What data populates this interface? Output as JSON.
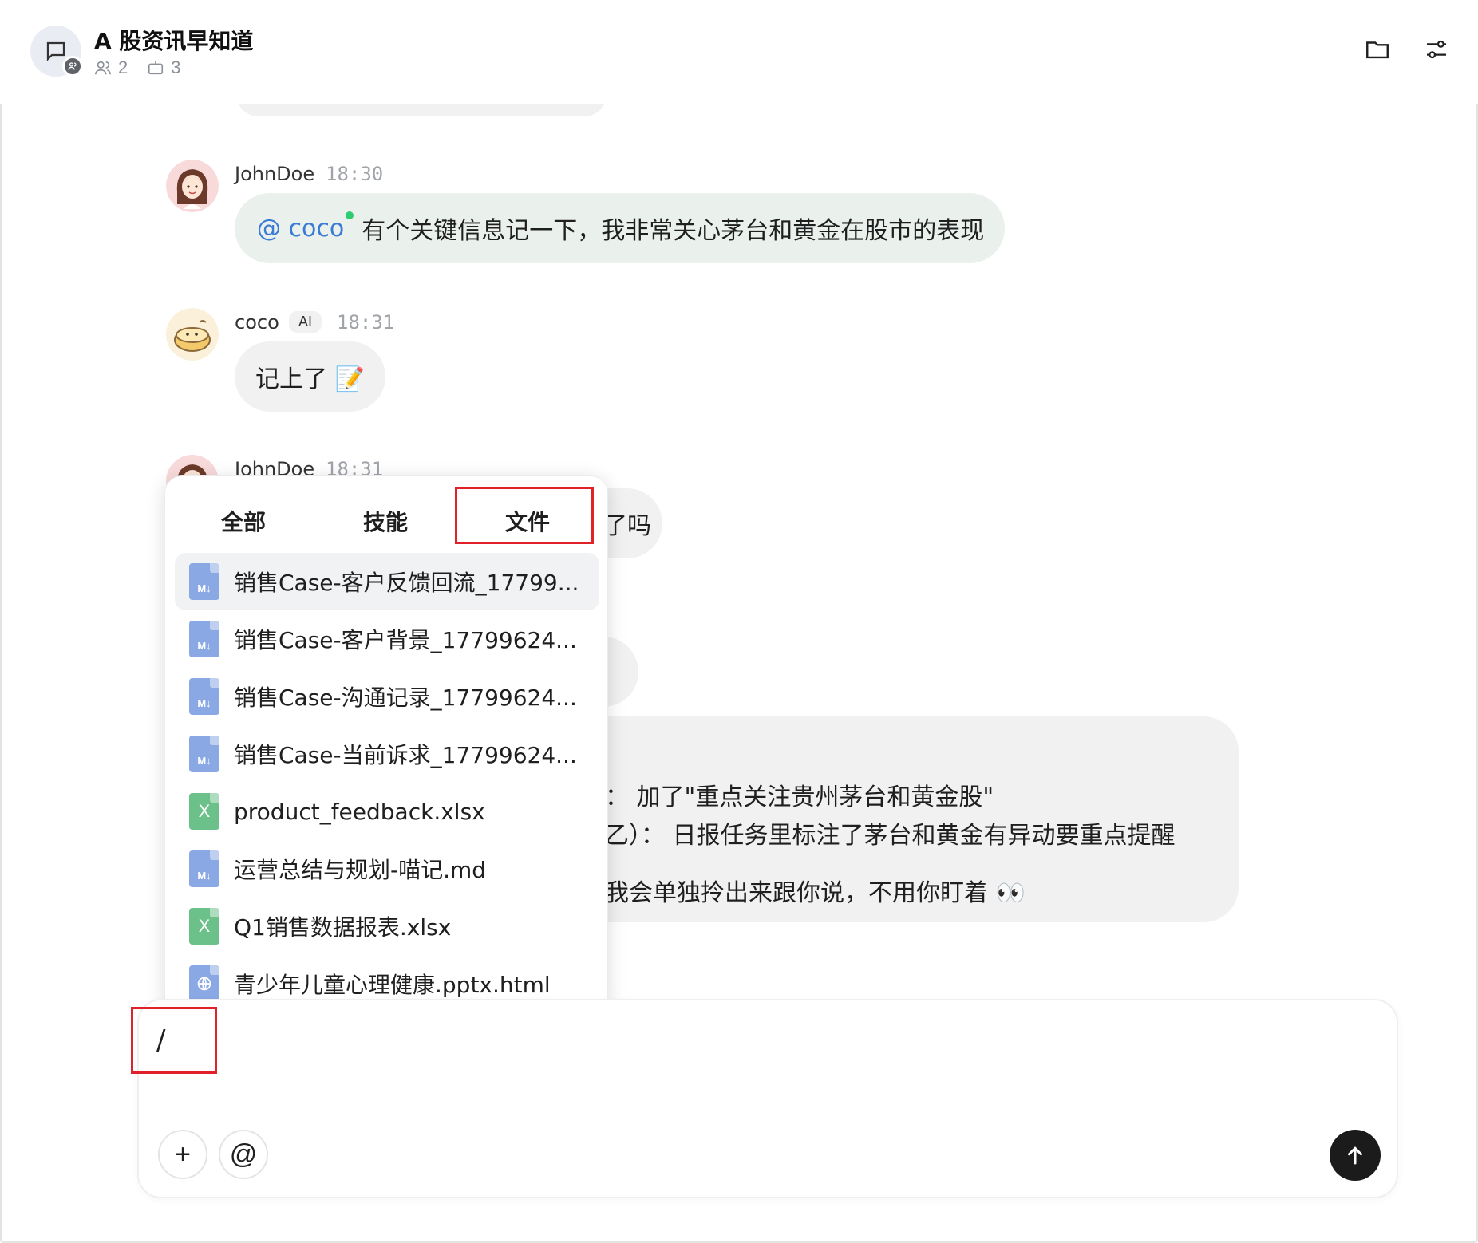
{
  "header": {
    "title": "A 股资讯早知道",
    "member_count": "2",
    "bot_count": "3"
  },
  "messages": [
    {
      "sender": "JohnDoe",
      "time": "18:30",
      "mention": "@ coco",
      "text": "有个关键信息记一下，我非常关心茅台和黄金在股市的表现"
    },
    {
      "sender": "coco",
      "tag": "AI",
      "time": "18:31",
      "text": "记上了 📝"
    },
    {
      "sender": "JohnDoe",
      "time": "18:31",
      "partial_text": "了吗"
    }
  ],
  "long_reply": {
    "line1": "：  加了\"重点关注贵州茅台和黄金股\"",
    "line2": "乙）：  日报任务里标注了茅台和黄金有异动要重点提醒",
    "line3": "我会单独拎出来跟你说，不用你盯着 👀"
  },
  "popup": {
    "tabs": [
      "全部",
      "技能",
      "文件"
    ],
    "active_tab": "文件",
    "files": [
      {
        "name": "销售Case-客户反馈回流_17799...",
        "type": "md"
      },
      {
        "name": "销售Case-客户背景_17799624...",
        "type": "md"
      },
      {
        "name": "销售Case-沟通记录_17799624...",
        "type": "md"
      },
      {
        "name": "销售Case-当前诉求_17799624...",
        "type": "md"
      },
      {
        "name": "product_feedback.xlsx",
        "type": "xlsx"
      },
      {
        "name": "运营总结与规划-喵记.md",
        "type": "md"
      },
      {
        "name": "Q1销售数据报表.xlsx",
        "type": "xlsx"
      },
      {
        "name": "青少年儿童心理健康.pptx.html",
        "type": "html"
      }
    ],
    "md_icon_label": "M↓",
    "xlsx_icon_label": "X"
  },
  "composer": {
    "value": "/",
    "plus_label": "+",
    "at_label": "@"
  },
  "colors": {
    "accent_blue": "#3a7bd5",
    "highlight_red": "#e0212a",
    "bubble_gray": "#f0f1f0",
    "online_green": "#2ecc71"
  }
}
